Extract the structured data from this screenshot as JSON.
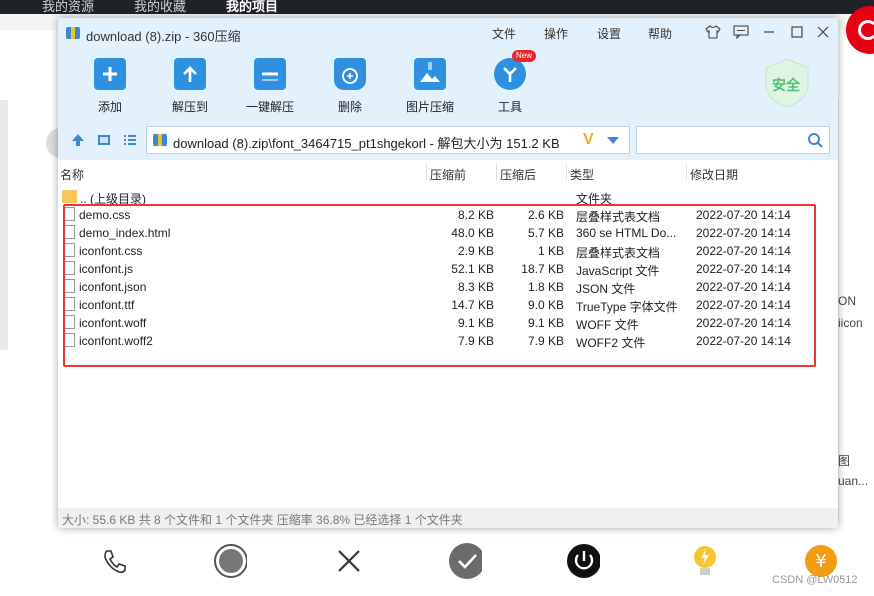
{
  "background": {
    "nav": [
      "我的资源",
      "我的收藏",
      "我的项目"
    ],
    "side_texts": [
      "ON",
      "iicon",
      "图",
      "uan..."
    ],
    "watermark": "CSDN @LW0512"
  },
  "window": {
    "title": "download (8).zip - 360压缩",
    "menus": [
      "文件",
      "操作",
      "设置",
      "帮助"
    ],
    "tools": [
      {
        "label": "添加",
        "icon": "add-icon"
      },
      {
        "label": "解压到",
        "icon": "extract-to-icon"
      },
      {
        "label": "一键解压",
        "icon": "one-click-extract-icon"
      },
      {
        "label": "删除",
        "icon": "delete-icon"
      },
      {
        "label": "图片压缩",
        "icon": "image-compress-icon"
      },
      {
        "label": "工具",
        "icon": "tools-icon"
      }
    ],
    "new_badge": "New",
    "security_label": "安全",
    "address": "download (8).zip\\font_3464715_pt1shgekorl - 解包大小为 151.2 KB",
    "address_v": "V",
    "search_placeholder": ""
  },
  "columns": {
    "name": "名称",
    "packed": "压缩前",
    "compressed": "压缩后",
    "type": "类型",
    "modified": "修改日期"
  },
  "parent_row": {
    "name": ".. (上级目录)",
    "type": "文件夹"
  },
  "files": [
    {
      "name": "demo.css",
      "packed": "8.2 KB",
      "compressed": "2.6 KB",
      "type": "层叠样式表文档",
      "modified": "2022-07-20 14:14"
    },
    {
      "name": "demo_index.html",
      "packed": "48.0 KB",
      "compressed": "5.7 KB",
      "type": "360 se HTML Do...",
      "modified": "2022-07-20 14:14"
    },
    {
      "name": "iconfont.css",
      "packed": "2.9 KB",
      "compressed": "1 KB",
      "type": "层叠样式表文档",
      "modified": "2022-07-20 14:14"
    },
    {
      "name": "iconfont.js",
      "packed": "52.1 KB",
      "compressed": "18.7 KB",
      "type": "JavaScript 文件",
      "modified": "2022-07-20 14:14"
    },
    {
      "name": "iconfont.json",
      "packed": "8.3 KB",
      "compressed": "1.8 KB",
      "type": "JSON 文件",
      "modified": "2022-07-20 14:14"
    },
    {
      "name": "iconfont.ttf",
      "packed": "14.7 KB",
      "compressed": "9.0 KB",
      "type": "TrueType 字体文件",
      "modified": "2022-07-20 14:14"
    },
    {
      "name": "iconfont.woff",
      "packed": "9.1 KB",
      "compressed": "9.1 KB",
      "type": "WOFF 文件",
      "modified": "2022-07-20 14:14"
    },
    {
      "name": "iconfont.woff2",
      "packed": "7.9 KB",
      "compressed": "7.9 KB",
      "type": "WOFF2 文件",
      "modified": "2022-07-20 14:14"
    }
  ],
  "status_text": "大小: 55.6 KB 共 8 个文件和 1 个文件夹 压缩率 36.8% 已经选择 1 个文件夹",
  "colors": {
    "accent": "#3d86d6",
    "highlight_box": "#e53935",
    "security": "#4cc26b"
  }
}
